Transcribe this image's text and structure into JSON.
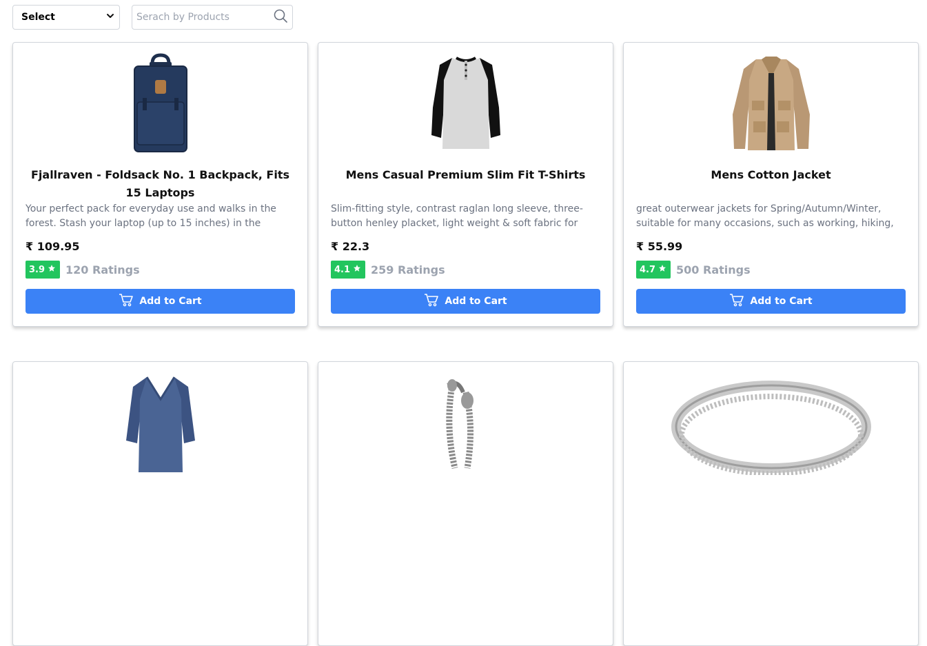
{
  "toolbar": {
    "select_value": "Select",
    "search_placeholder": "Serach by Products"
  },
  "colors": {
    "accent": "#3b82f6",
    "rating_green": "#22c55e"
  },
  "products": [
    {
      "title": "Fjallraven - Foldsack No. 1 Backpack, Fits 15 Laptops",
      "description": "Your perfect pack for everyday use and walks in the forest. Stash your laptop (up to 15 inches) in the padded sleeve,",
      "price": "₹ 109.95",
      "rating": "3.9",
      "rating_count": "120 Ratings",
      "button_label": "Add to Cart",
      "image": "backpack"
    },
    {
      "title": "Mens Casual Premium Slim Fit T-Shirts",
      "description": "Slim-fitting style, contrast raglan long sleeve, three-button henley placket, light weight & soft fabric for breathable and",
      "price": "₹ 22.3",
      "rating": "4.1",
      "rating_count": "259 Ratings",
      "button_label": "Add to Cart",
      "image": "raglan-tshirt"
    },
    {
      "title": "Mens Cotton Jacket",
      "description": "great outerwear jackets for Spring/Autumn/Winter, suitable for many occasions, such as working, hiking, camping,",
      "price": "₹ 55.99",
      "rating": "4.7",
      "rating_count": "500 Ratings",
      "button_label": "Add to Cart",
      "image": "cotton-jacket"
    },
    {
      "image": "longsleeve-shirt"
    },
    {
      "image": "chain-bracelet"
    },
    {
      "image": "silver-ring"
    }
  ]
}
